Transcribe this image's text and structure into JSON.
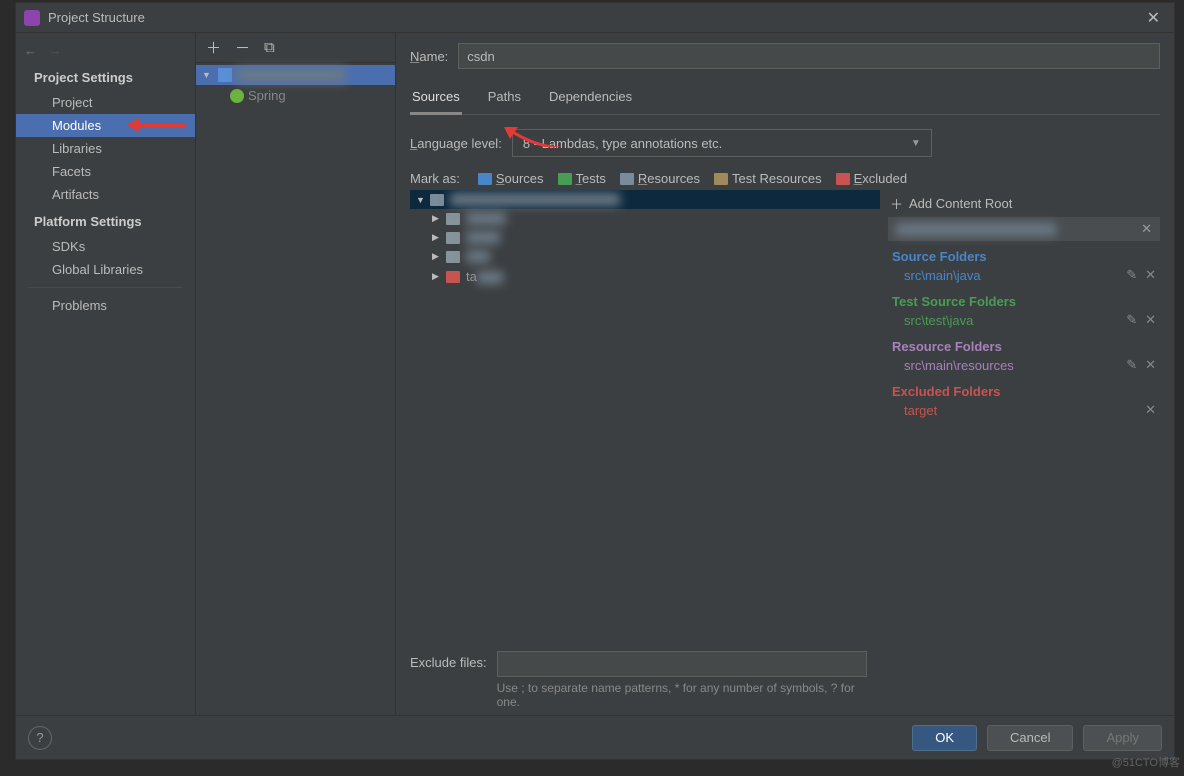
{
  "window": {
    "title": "Project Structure"
  },
  "sidebar": {
    "sections": [
      {
        "heading": "Project Settings",
        "items": [
          "Project",
          "Modules",
          "Libraries",
          "Facets",
          "Artifacts"
        ]
      },
      {
        "heading": "Platform Settings",
        "items": [
          "SDKs",
          "Global Libraries"
        ]
      }
    ],
    "extra": "Problems"
  },
  "moduleTree": {
    "child": "Spring"
  },
  "main": {
    "nameLabel": "Name:",
    "nameValue": "csdn",
    "tabs": [
      "Sources",
      "Paths",
      "Dependencies"
    ],
    "langLabel": "Language level:",
    "langValue": "8 - Lambdas, type annotations etc.",
    "markAsLabel": "Mark as:",
    "markButtons": [
      {
        "label": "Sources",
        "color": "#4a86c7"
      },
      {
        "label": "Tests",
        "color": "#499c54"
      },
      {
        "label": "Resources",
        "color": "#7a8b99"
      },
      {
        "label": "Test Resources",
        "color": "#a0895b"
      },
      {
        "label": "Excluded",
        "color": "#c75450"
      }
    ],
    "dirTree": {
      "children": [
        "",
        "",
        "",
        "ta..."
      ],
      "lastColor": "#c75450"
    },
    "addContentRoot": "Add Content Root",
    "folderGroups": [
      {
        "title": "Source Folders",
        "color": "#4a86c7",
        "items": [
          {
            "path": "src\\main\\java",
            "edit": true,
            "close": true
          }
        ]
      },
      {
        "title": "Test Source Folders",
        "color": "#499c54",
        "items": [
          {
            "path": "src\\test\\java",
            "edit": true,
            "close": true
          }
        ]
      },
      {
        "title": "Resource Folders",
        "color": "#a781ba",
        "items": [
          {
            "path": "src\\main\\resources",
            "edit": true,
            "close": true
          }
        ]
      },
      {
        "title": "Excluded Folders",
        "color": "#c75450",
        "items": [
          {
            "path": "target",
            "edit": false,
            "close": true
          }
        ]
      }
    ],
    "excludeLabel": "Exclude files:",
    "excludeValue": "",
    "excludeHint": "Use ; to separate name patterns, * for any number of symbols, ? for one."
  },
  "footer": {
    "ok": "OK",
    "cancel": "Cancel",
    "apply": "Apply"
  },
  "watermark": "@51CTO博客"
}
